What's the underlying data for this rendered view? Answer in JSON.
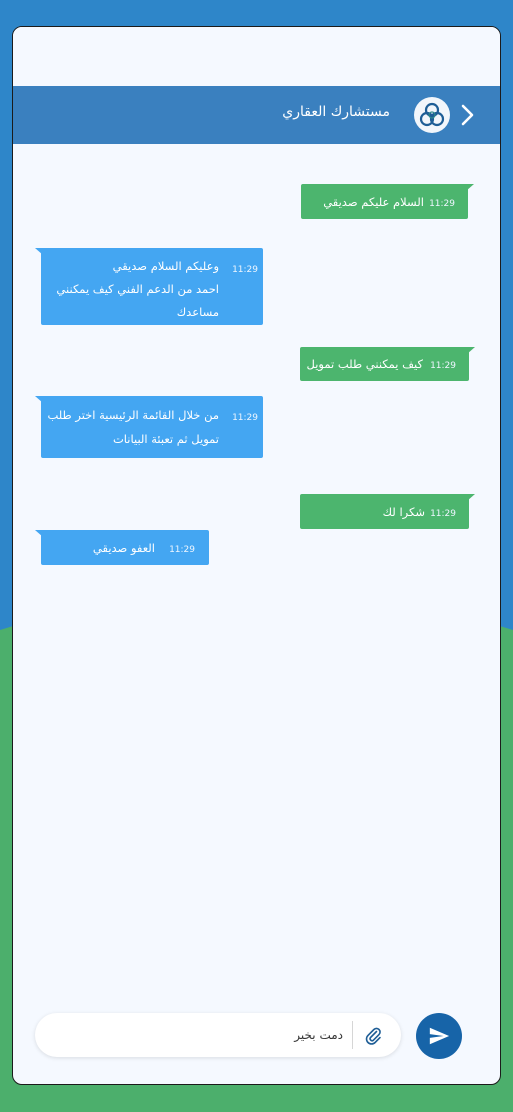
{
  "header": {
    "title": "مستشارك العقاري",
    "back_icon": "chevron-right-icon",
    "logo_icon": "knot-logo-icon"
  },
  "messages": [
    {
      "direction": "out",
      "lines": [
        "السلام عليكم صديقي"
      ],
      "time": "11:29"
    },
    {
      "direction": "in",
      "lines": [
        "وعليكم السلام صديقي",
        "احمد من الدعم الفني كيف يمكنني",
        "مساعدك"
      ],
      "time": "11:29"
    },
    {
      "direction": "out",
      "lines": [
        "كيف يمكنني طلب تمويل"
      ],
      "time": "11:29"
    },
    {
      "direction": "in",
      "lines": [
        "من خلال القائمة الرئيسية اختر طلب",
        "تمويل ثم تعبئة البيانات"
      ],
      "time": "11:29"
    },
    {
      "direction": "out",
      "lines": [
        "شكرا لك"
      ],
      "time": "11:29"
    },
    {
      "direction": "in",
      "lines": [
        "العفو صديقي"
      ],
      "time": "11:29"
    }
  ],
  "composer": {
    "value": "دمت بخير",
    "attach_icon": "paperclip-icon",
    "send_icon": "send-icon"
  },
  "colors": {
    "header": "#3a80bf",
    "outgoing": "#4cb56e",
    "incoming": "#44a6f2",
    "send_button": "#1764a8",
    "background_top": "#2e86c9",
    "background_bottom": "#4caf6c"
  }
}
